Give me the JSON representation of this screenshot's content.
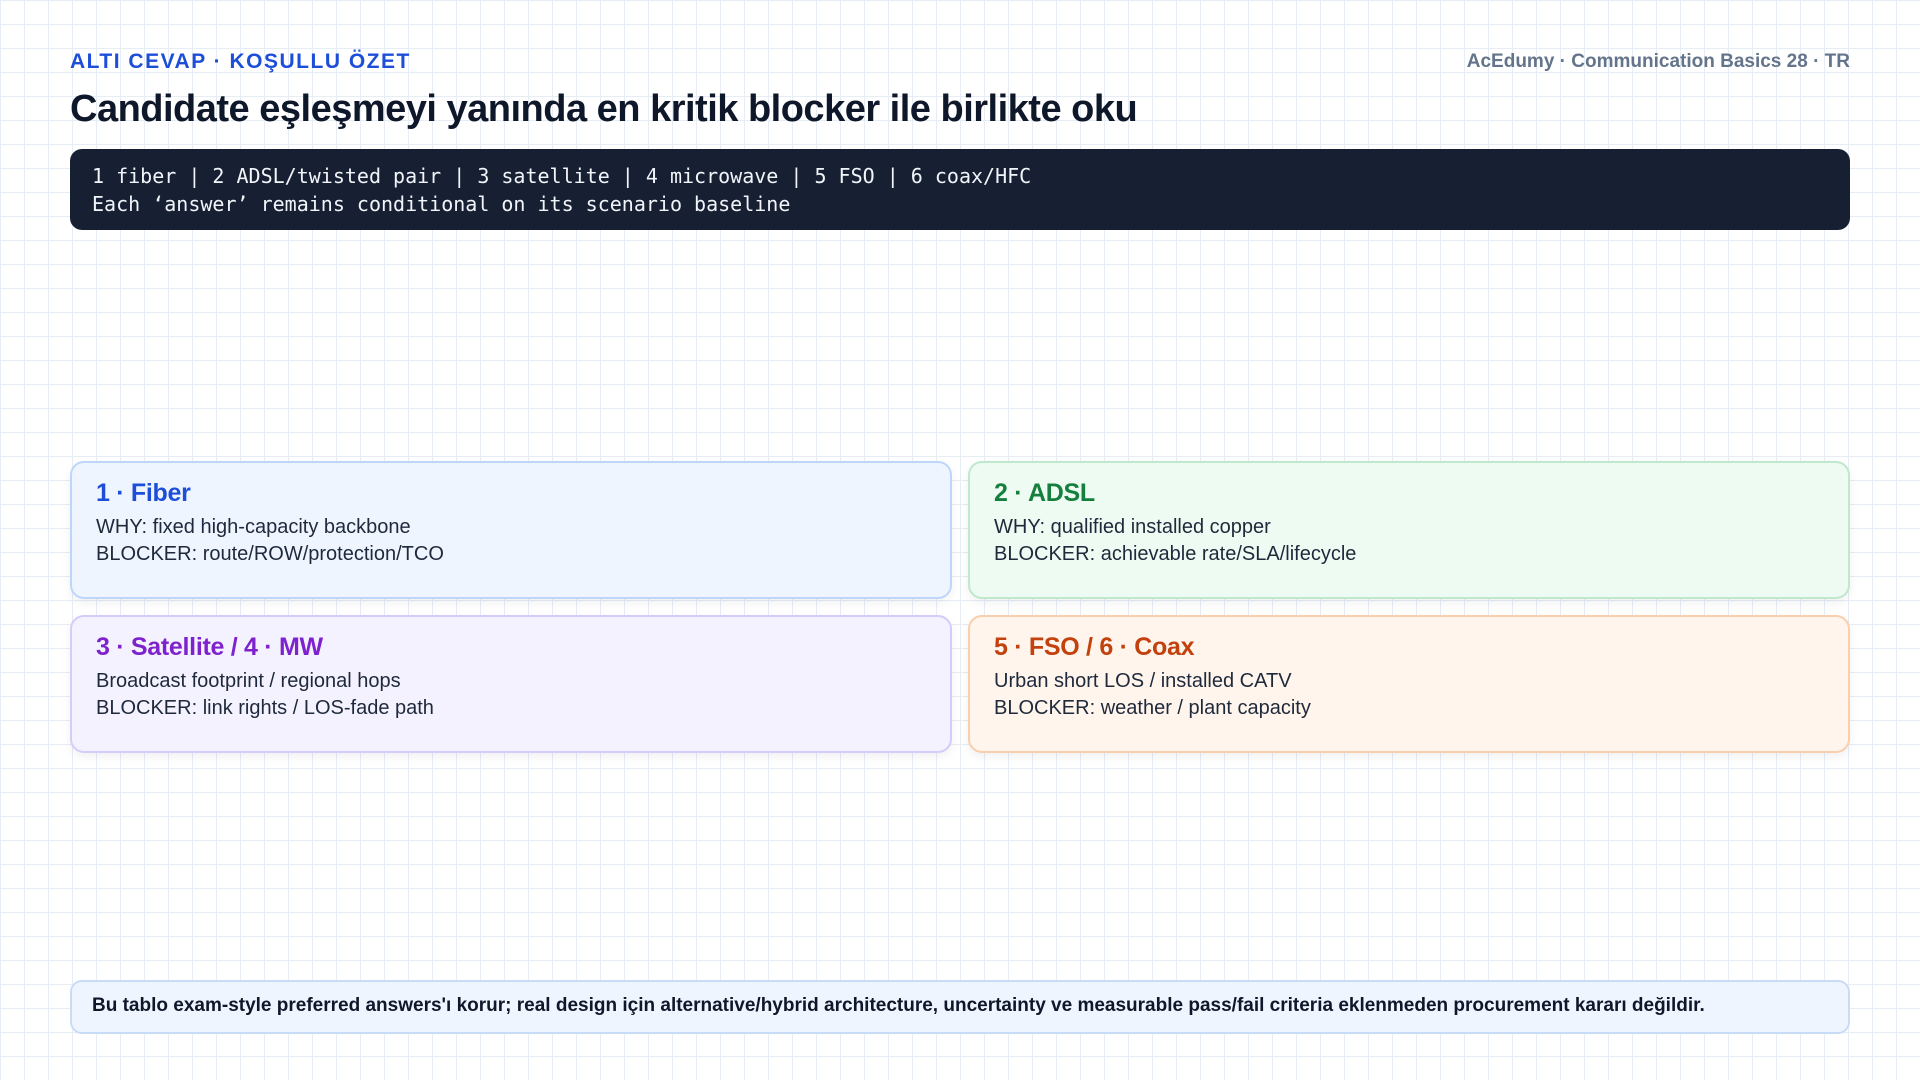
{
  "header": {
    "kicker": "ALTI CEVAP · KOŞULLU ÖZET",
    "brand": "AcEdumy · Communication Basics 28 · TR",
    "title": "Candidate eşleşmeyi yanında en kritik blocker ile birlikte oku"
  },
  "code_block": {
    "line1": "1 fiber | 2 ADSL/twisted pair | 3 satellite | 4 microwave | 5 FSO | 6 coax/HFC",
    "line2": "Each ‘answer’ remains conditional on its scenario baseline"
  },
  "cards": [
    {
      "title": "1 · Fiber",
      "line1": "WHY: fixed high-capacity backbone",
      "line2": "BLOCKER: route/ROW/protection/TCO",
      "accent": "#1d4ed8"
    },
    {
      "title": "2 · ADSL",
      "line1": "WHY: qualified installed copper",
      "line2": "BLOCKER: achievable rate/SLA/lifecycle",
      "accent": "#15803d"
    },
    {
      "title": "3 · Satellite / 4 · MW",
      "line1": "Broadcast footprint / regional hops",
      "line2": "BLOCKER: link rights / LOS-fade path",
      "accent": "#7e22ce"
    },
    {
      "title": "5 · FSO / 6 · Coax",
      "line1": "Urban short LOS / installed CATV",
      "line2": "BLOCKER: weather / plant capacity",
      "accent": "#c2410c"
    }
  ],
  "footer": {
    "note": "Bu tablo exam-style preferred answers'ı korur; real design için alternative/hybrid architecture, uncertainty ve measurable pass/fail criteria eklenmeden procurement kararı değildir."
  }
}
